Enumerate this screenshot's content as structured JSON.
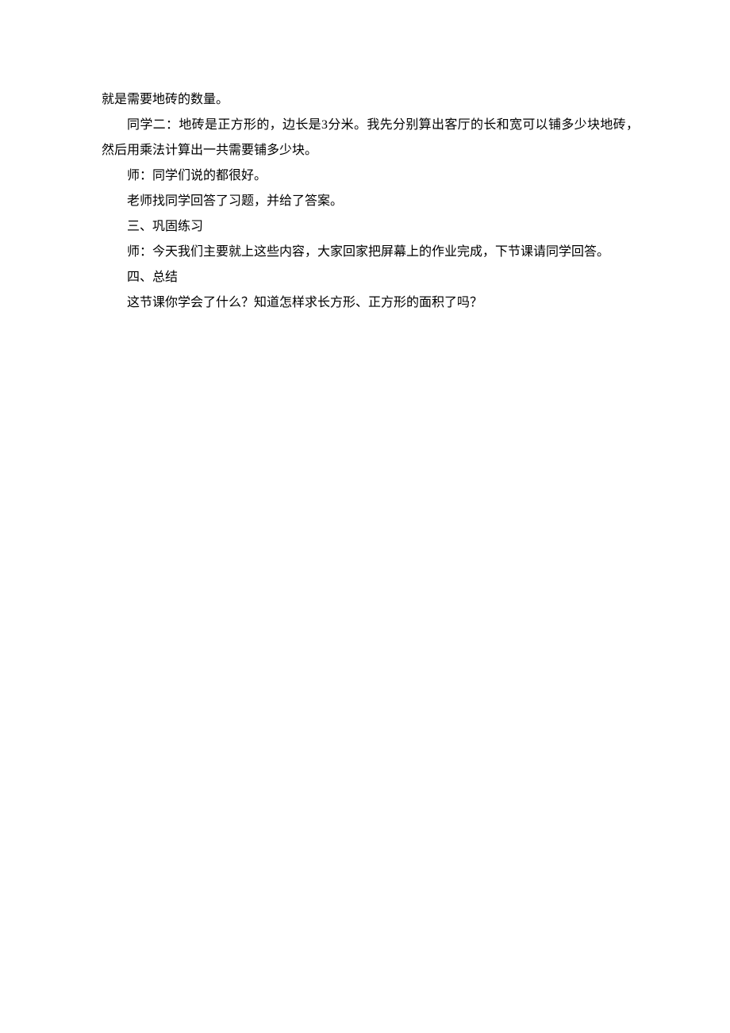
{
  "paragraphs": [
    {
      "text": "就是需要地砖的数量。",
      "indent": false
    },
    {
      "text": "同学二：地砖是正方形的，边长是3分米。我先分别算出客厅的长和宽可以铺多少块地砖，然后用乘法计算出一共需要铺多少块。",
      "indent": true
    },
    {
      "text": "师：同学们说的都很好。",
      "indent": true
    },
    {
      "text": "老师找同学回答了习题，并给了答案。",
      "indent": true
    },
    {
      "text": "三、巩固练习",
      "indent": true
    },
    {
      "text": "师：今天我们主要就上这些内容，大家回家把屏幕上的作业完成，下节课请同学回答。",
      "indent": true
    },
    {
      "text": "四、总结",
      "indent": true
    },
    {
      "text": "这节课你学会了什么？知道怎样求长方形、正方形的面积了吗？",
      "indent": true
    }
  ]
}
